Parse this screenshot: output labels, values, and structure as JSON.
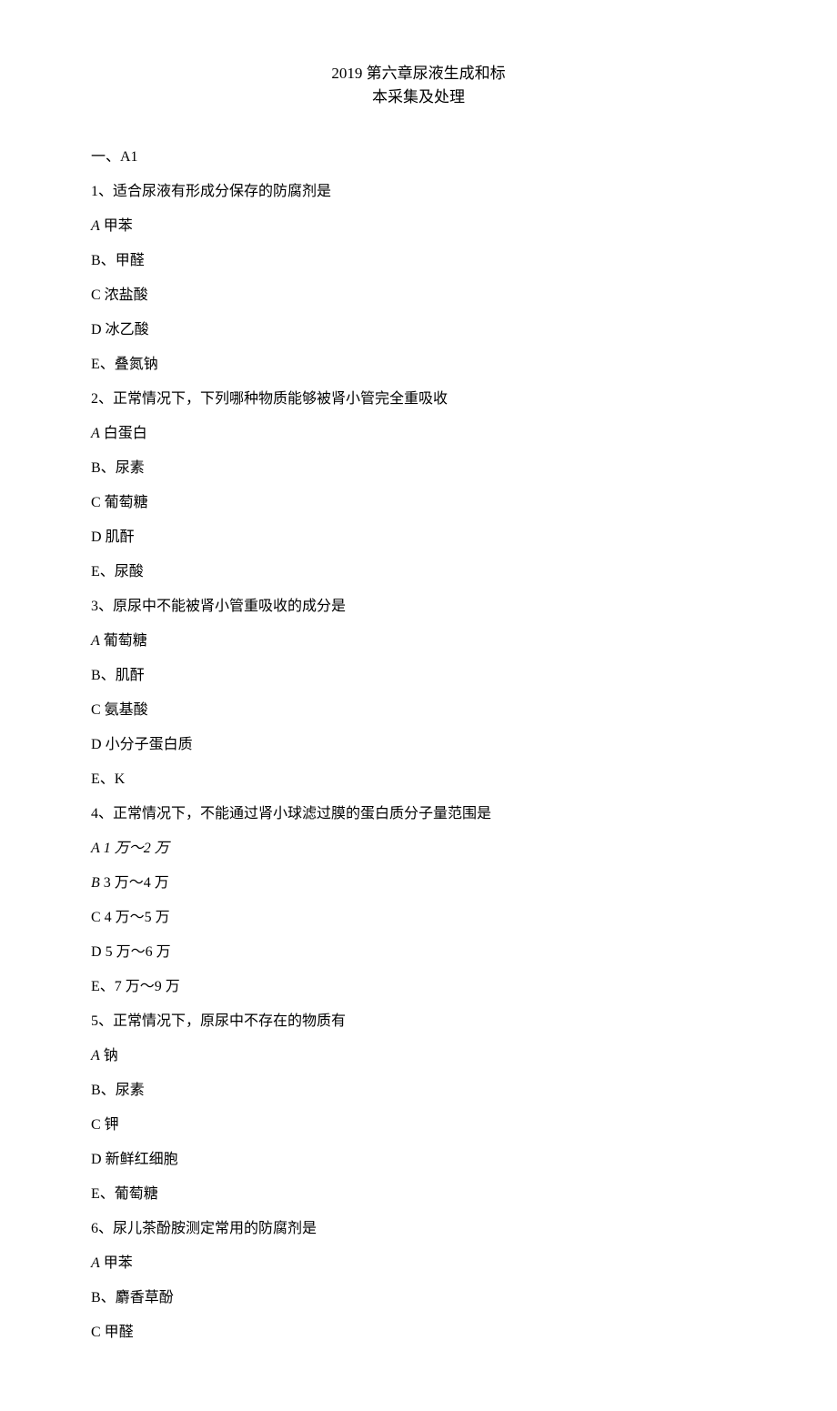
{
  "title": {
    "line1": "2019 第六章尿液生成和标",
    "line2": "本采集及处理"
  },
  "section_heading": "一、A1",
  "questions": [
    {
      "stem": "1、适合尿液有形成分保存的防腐剂是",
      "options": [
        {
          "prefix": "A",
          "sep": " ",
          "text": "甲苯",
          "italic_prefix": true
        },
        {
          "prefix": "B",
          "sep": "、",
          "text": "甲醛"
        },
        {
          "prefix": "C",
          "sep": " ",
          "text": "浓盐酸"
        },
        {
          "prefix": "D",
          "sep": " ",
          "text": "冰乙酸"
        },
        {
          "prefix": "E",
          "sep": "、",
          "text": "叠氮钠"
        }
      ]
    },
    {
      "stem": "2、正常情况下，下列哪种物质能够被肾小管完全重吸收",
      "options": [
        {
          "prefix": "A",
          "sep": " ",
          "text": "白蛋白",
          "italic_prefix": true
        },
        {
          "prefix": "B",
          "sep": "、",
          "text": "尿素"
        },
        {
          "prefix": "C",
          "sep": " ",
          "text": "葡萄糖"
        },
        {
          "prefix": "D",
          "sep": " ",
          "text": "肌酐"
        },
        {
          "prefix": "E",
          "sep": "、",
          "text": "尿酸"
        }
      ]
    },
    {
      "stem": "3、原尿中不能被肾小管重吸收的成分是",
      "options": [
        {
          "prefix": "A",
          "sep": " ",
          "text": "葡萄糖",
          "italic_prefix": true
        },
        {
          "prefix": "B",
          "sep": "、",
          "text": "肌酐"
        },
        {
          "prefix": "C",
          "sep": " ",
          "text": "氨基酸"
        },
        {
          "prefix": "D",
          "sep": " ",
          "text": "小分子蛋白质"
        },
        {
          "prefix": "E",
          "sep": "、",
          "text": "K"
        }
      ]
    },
    {
      "stem": "4、正常情况下，不能通过肾小球滤过膜的蛋白质分子量范围是",
      "options": [
        {
          "prefix": "A",
          "sep": " ",
          "text": "1 万～2 万",
          "italic_prefix": true,
          "italic_all": true
        },
        {
          "prefix": "B",
          "sep": " ",
          "text": "3 万～4 万",
          "italic_prefix": true
        },
        {
          "prefix": "C",
          "sep": " ",
          "text": "4 万～5 万"
        },
        {
          "prefix": "D",
          "sep": " ",
          "text": "5 万～6 万"
        },
        {
          "prefix": "E",
          "sep": "、",
          "text": "7 万～9 万"
        }
      ]
    },
    {
      "stem": "5、正常情况下，原尿中不存在的物质有",
      "options": [
        {
          "prefix": "A",
          "sep": " ",
          "text": "钠",
          "italic_prefix": true
        },
        {
          "prefix": "B",
          "sep": "、",
          "text": "尿素"
        },
        {
          "prefix": "C",
          "sep": " ",
          "text": "钾"
        },
        {
          "prefix": "D",
          "sep": " ",
          "text": "新鲜红细胞"
        },
        {
          "prefix": "E",
          "sep": "、",
          "text": "葡萄糖"
        }
      ]
    },
    {
      "stem": "6、尿儿茶酚胺测定常用的防腐剂是",
      "options": [
        {
          "prefix": "A",
          "sep": " ",
          "text": "甲苯",
          "italic_prefix": true
        },
        {
          "prefix": "B",
          "sep": "、",
          "text": "麝香草酚"
        },
        {
          "prefix": "C",
          "sep": " ",
          "text": "甲醛"
        }
      ]
    }
  ]
}
